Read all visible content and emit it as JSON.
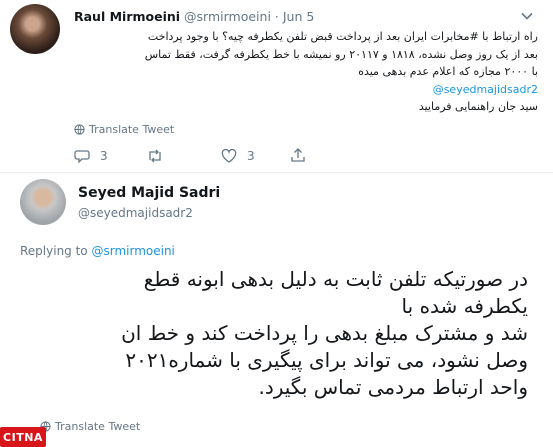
{
  "tweet1": {
    "display_name": "Raul Mirmoeini",
    "handle": "@srmirmoeini",
    "separator": "·",
    "date": "Jun 5",
    "lines": [
      "راه ارتباط با #مخابرات ایران بعد از پرداخت قبض تلفن یکطرفه چیه؟ با وجود پرداخت",
      "بعد از یک روز وصل نشده، ۱۸۱۸ و ۲۰۱۱۷ رو نمیشه با خط یکطرفه گرفت، فقط تماس",
      "با ۲۰۰۰ مجازه که اعلام عدم بدهی میده"
    ],
    "mention": "@seyedmajidsadr2",
    "last_line": "سید جان راهنمایی فرمایید",
    "translate": "Translate Tweet",
    "reply_count": "3",
    "retweet_count": "",
    "like_count": "3"
  },
  "tweet2": {
    "display_name": "Seyed Majid Sadri",
    "handle": "@seyedmajidsadr2",
    "replying_prefix": "Replying to",
    "replying_handle": "@srmirmoeini",
    "body_lines": [
      "در صورتیکه تلفن ثابت به دلیل بدهی ابونه قطع",
      "یکطرفه شده با",
      "شد و مشترک مبلغ بدهی را پرداخت کند و خط ان",
      "وصل نشود، می تواند برای پیگیری با شماره۲۰۲۱",
      "واحد ارتباط مردمی تماس بگیرد."
    ],
    "translate": "Translate Tweet"
  },
  "watermark": {
    "text": "CITNA",
    "color": "#d7151b"
  },
  "colors": {
    "link": "#1b95e0",
    "muted": "#657786",
    "text": "#14171a"
  }
}
